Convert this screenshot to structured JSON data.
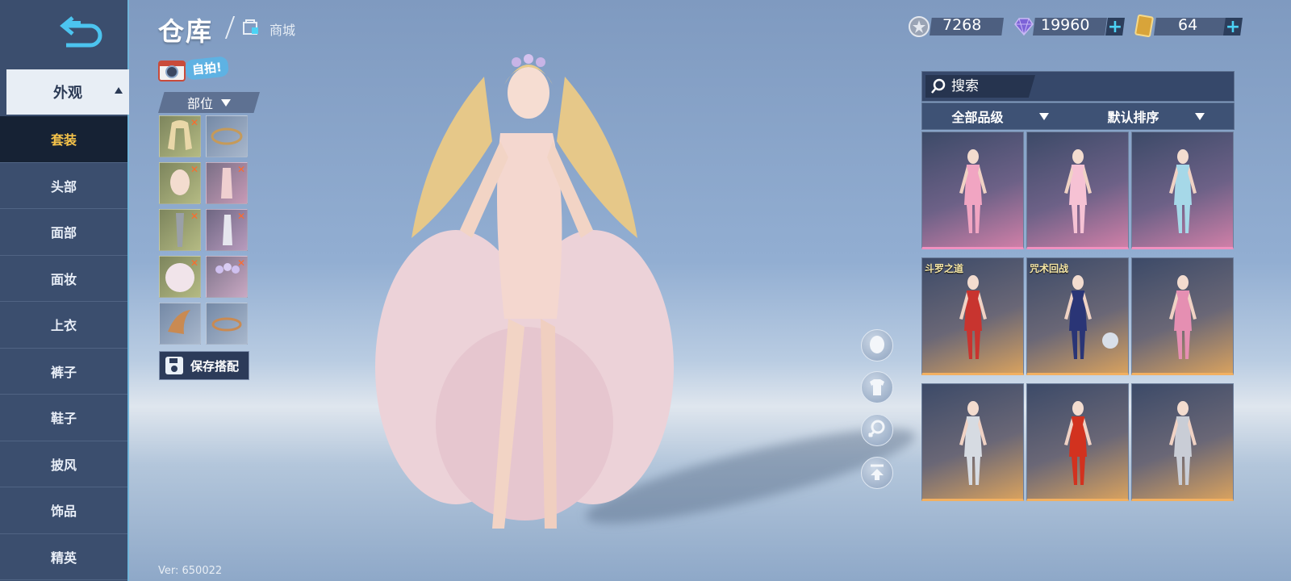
{
  "header": {
    "title": "仓库",
    "shop_link": "商城"
  },
  "currency": [
    {
      "name": "silver-coin",
      "value": "7268"
    },
    {
      "name": "diamond",
      "value": "19960"
    },
    {
      "name": "ticket",
      "value": "64"
    }
  ],
  "selfie": {
    "label": "自拍!"
  },
  "sidebar": {
    "header": "外观",
    "items": [
      {
        "label": "套装",
        "active": true
      },
      {
        "label": "头部"
      },
      {
        "label": "面部"
      },
      {
        "label": "面妆"
      },
      {
        "label": "上衣"
      },
      {
        "label": "裤子"
      },
      {
        "label": "鞋子"
      },
      {
        "label": "披风"
      },
      {
        "label": "饰品"
      },
      {
        "label": "精英"
      }
    ]
  },
  "parts": {
    "dropdown_label": "部位",
    "save_label": "保存搭配"
  },
  "search": {
    "placeholder": "搜索"
  },
  "filters": {
    "quality": "全部品级",
    "sort": "默认排序"
  },
  "cards": [
    {
      "tag": "",
      "rarity": "pink",
      "color": "#f1a5c2"
    },
    {
      "tag": "",
      "rarity": "pink",
      "color": "#f6c2d4"
    },
    {
      "tag": "",
      "rarity": "pink",
      "color": "#a6d8e8"
    },
    {
      "tag": "斗罗之道",
      "rarity": "gold",
      "color": "#c8342f"
    },
    {
      "tag": "咒术回战",
      "rarity": "gold",
      "color": "#2a3576"
    },
    {
      "tag": "",
      "rarity": "gold",
      "color": "#e58fb2"
    },
    {
      "tag": "",
      "rarity": "gold",
      "color": "#d6dbe2"
    },
    {
      "tag": "",
      "rarity": "gold",
      "color": "#d2321f"
    },
    {
      "tag": "",
      "rarity": "gold",
      "color": "#c9cdd6"
    }
  ],
  "version": "Ver: 650022",
  "colors": {
    "sidebar": "#3b4e6e",
    "active_item_text": "#f5c34a",
    "accent": "#4cd2f5"
  }
}
